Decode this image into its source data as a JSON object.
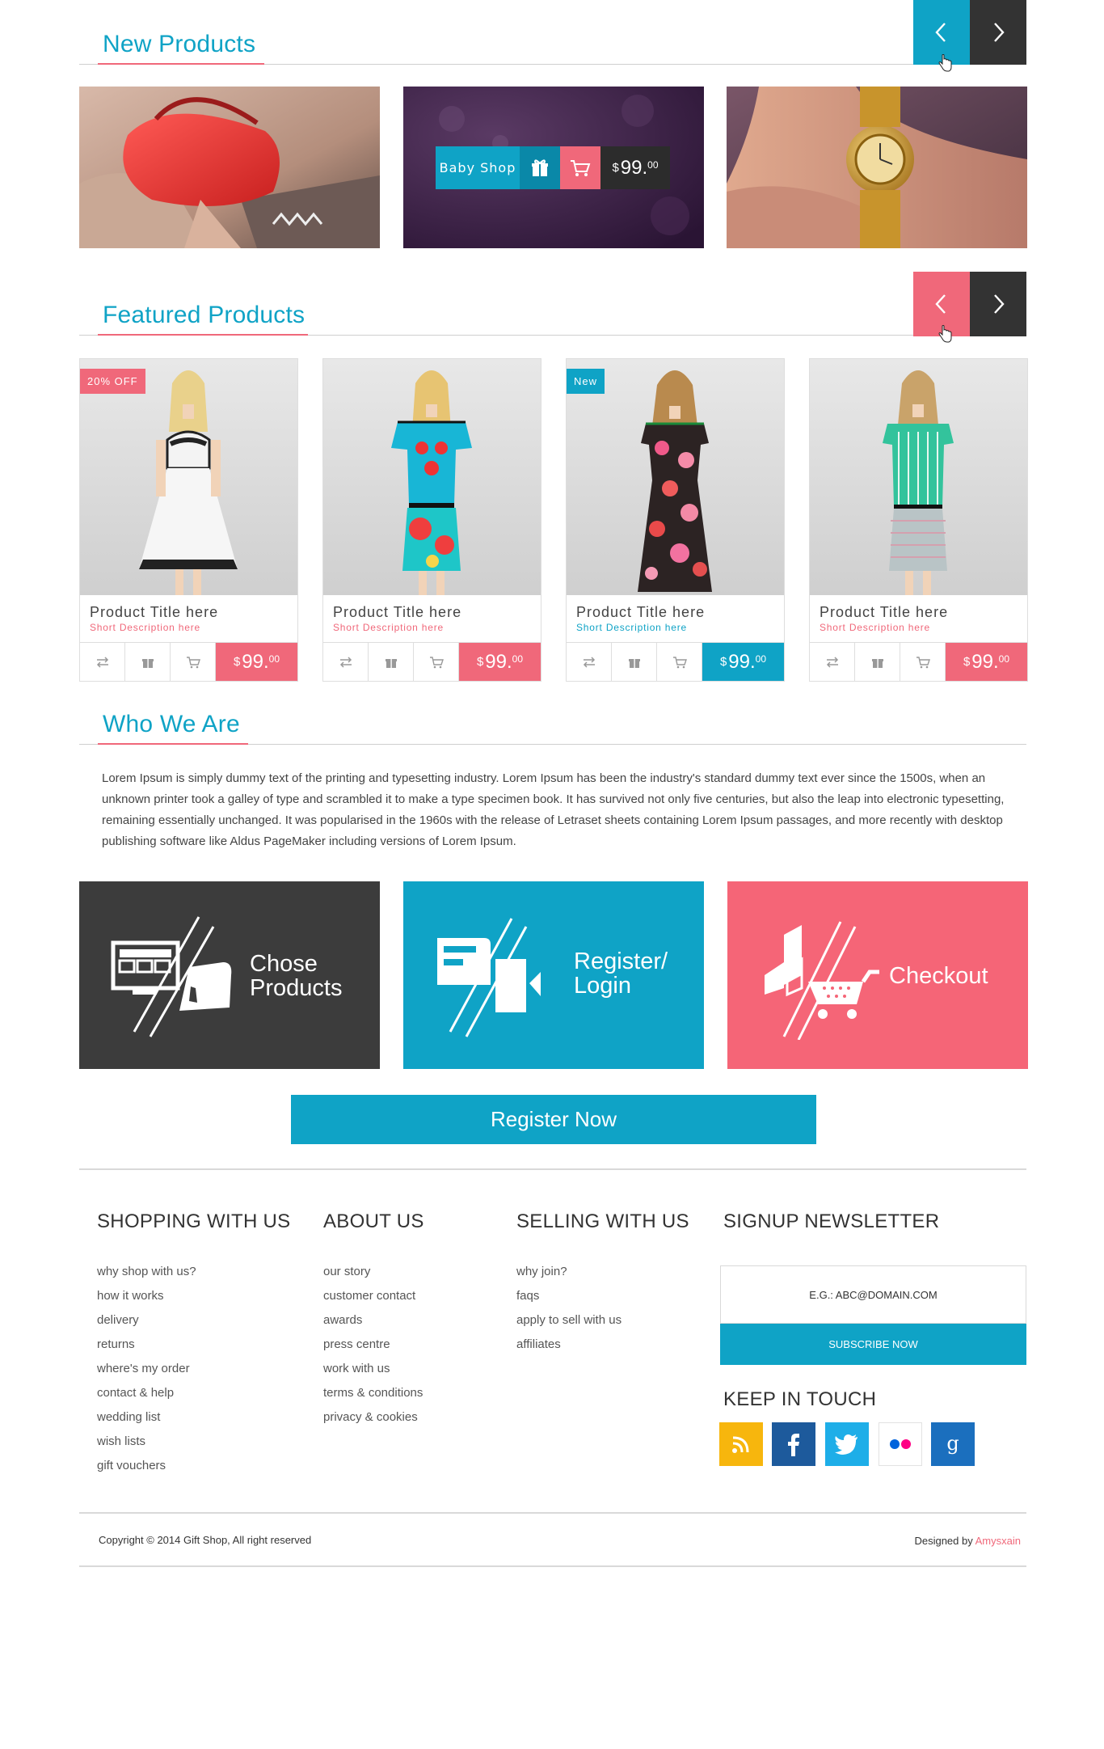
{
  "new_products": {
    "title": "New Products",
    "overlay": {
      "label": "Baby Shop",
      "gift_icon": "gift-icon",
      "cart_icon": "cart-icon",
      "currency": "$",
      "price": "99.",
      "cents": "00"
    }
  },
  "featured": {
    "title": "Featured Products",
    "products": [
      {
        "badge": "20% OFF",
        "badge_color": "#f0687a",
        "title": "Product Title here",
        "desc": "Short Description here",
        "desc_color": "#f0687a",
        "currency": "$",
        "price": "99.",
        "cents": "00",
        "price_color": "#f0687a"
      },
      {
        "badge": "",
        "title": "Product Title here",
        "desc": "Short Description here",
        "desc_color": "#f0687a",
        "currency": "$",
        "price": "99.",
        "cents": "00",
        "price_color": "#f0687a"
      },
      {
        "badge": "New",
        "badge_color": "#0fa3c6",
        "title": "Product Title here",
        "desc": "Short Description here",
        "desc_color": "#0fa3c6",
        "currency": "$",
        "price": "99.",
        "cents": "00",
        "price_color": "#0fa3c6"
      },
      {
        "badge": "",
        "title": "Product Title here",
        "desc": "Short Description here",
        "desc_color": "#f0687a",
        "currency": "$",
        "price": "99.",
        "cents": "00",
        "price_color": "#f0687a"
      }
    ]
  },
  "who": {
    "title": "Who We Are",
    "text": "Lorem Ipsum is simply dummy text of the printing and typesetting industry. Lorem Ipsum has been the industry's standard dummy text ever since the 1500s, when an unknown printer took a galley of type and scrambled it to make a type specimen book. It has survived not only five centuries, but also the leap into electronic typesetting, remaining essentially unchanged. It was popularised in the 1960s with the release of Letraset sheets containing Lorem Ipsum passages, and more recently with desktop publishing software like Aldus PageMaker including versions of Lorem Ipsum."
  },
  "steps": {
    "one": {
      "line1": "Chose",
      "line2": "Products"
    },
    "two": {
      "line1": "Register/",
      "line2": "Login"
    },
    "three": {
      "line1": "Checkout"
    }
  },
  "register_button": "Register Now",
  "footer": {
    "shopping": {
      "title": "SHOPPING WITH US",
      "items": [
        "why shop with us?",
        "how it works",
        "delivery",
        "returns",
        "where's my order",
        "contact & help",
        "wedding list",
        "wish lists",
        "gift vouchers"
      ]
    },
    "about": {
      "title": "ABOUT US",
      "items": [
        "our story",
        "customer contact",
        "awards",
        "press centre",
        "work with us",
        "terms & conditions",
        "privacy & cookies"
      ]
    },
    "selling": {
      "title": "SELLING WITH US",
      "items": [
        "why join?",
        "faqs",
        "apply to sell with us",
        "affiliates"
      ]
    },
    "newsletter": {
      "title": "SIGNUP NEWSLETTER",
      "placeholder": "E.G.: ABC@DOMAIN.COM",
      "button": "SUBSCRIBE NOW"
    },
    "keep_in_touch": {
      "title": "KEEP IN TOUCH",
      "icons": [
        "rss-icon",
        "facebook-icon",
        "twitter-icon",
        "flickr-icon",
        "google-plus-icon"
      ]
    },
    "copyright": "Copyright © 2014 Gift Shop,  All right reserved",
    "designed_by": "Designed by",
    "designer": "Amysxain"
  },
  "colors": {
    "accent_blue": "#0fa3c6",
    "accent_pink": "#f0687a",
    "dark": "#3a3a3a"
  }
}
